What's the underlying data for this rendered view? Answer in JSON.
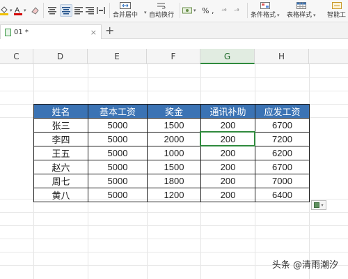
{
  "ribbon": {
    "merge_center": "合并居中",
    "auto_wrap": "自动换行",
    "percent": "%",
    "comma": ",",
    "dec_inc": "⁺⁰",
    "dec_dec": "⁻⁰",
    "conditional_format": "条件格式",
    "table_style": "表格样式",
    "smart": "智能工"
  },
  "tab": {
    "name": "01 *",
    "close": "×",
    "new": "+"
  },
  "columns": [
    {
      "label": "C"
    },
    {
      "label": "D"
    },
    {
      "label": "E"
    },
    {
      "label": "F"
    },
    {
      "label": "G",
      "selected": true
    },
    {
      "label": "H"
    }
  ],
  "table": {
    "headers": [
      "姓名",
      "基本工资",
      "奖金",
      "通讯补助",
      "应发工资"
    ],
    "rows": [
      [
        "张三",
        "5000",
        "1500",
        "200",
        "6700"
      ],
      [
        "李四",
        "5000",
        "2000",
        "200",
        "7200"
      ],
      [
        "王五",
        "5000",
        "1000",
        "200",
        "6200"
      ],
      [
        "赵六",
        "5000",
        "1500",
        "200",
        "6700"
      ],
      [
        "周七",
        "5000",
        "1800",
        "200",
        "7000"
      ],
      [
        "黄八",
        "5000",
        "1200",
        "200",
        "6400"
      ]
    ]
  },
  "watermark": "头条 @清雨潮汐",
  "colors": {
    "header_fill": "#3b73b4",
    "selection": "#2f8a3d"
  }
}
